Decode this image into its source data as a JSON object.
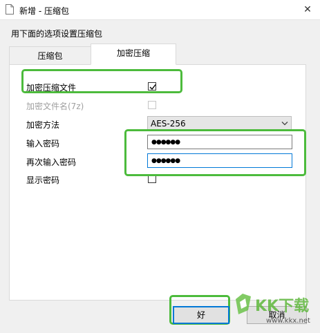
{
  "window": {
    "title": "新增 - 压缩包",
    "close_label": "✕"
  },
  "instruction": "用下面的选项设置压缩包",
  "tabs": [
    {
      "label": "压缩包",
      "selected": false
    },
    {
      "label": "加密压缩",
      "selected": true
    }
  ],
  "form": {
    "encrypt_label": "加密压缩文件",
    "encrypt_checked": true,
    "encrypt_names_label": "加密文件名(7z)",
    "encrypt_names_checked": false,
    "encrypt_names_enabled": false,
    "method_label": "加密方法",
    "method_value": "AES-256",
    "password_label": "输入密码",
    "password_value": "●●●●●●",
    "confirm_label": "再次输入密码",
    "confirm_value": "●●●●●●",
    "show_password_label": "显示密码",
    "show_password_checked": false
  },
  "buttons": {
    "ok": "好",
    "cancel": "取消"
  },
  "watermark": {
    "brand": "KK下载",
    "url": "www.kkx.net"
  },
  "colors": {
    "highlight": "#4cbb3c",
    "focus": "#0078d7"
  }
}
